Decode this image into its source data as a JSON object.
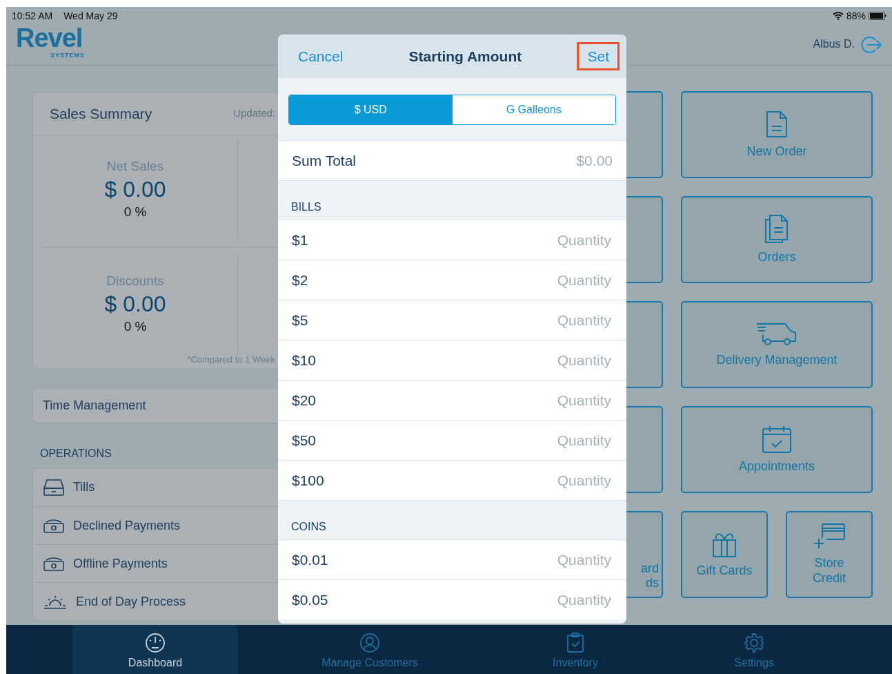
{
  "status_bar": {
    "time": "10:52 AM",
    "date": "Wed May 29",
    "battery": "88%"
  },
  "header": {
    "logo": "Revel",
    "logo_sub": "SYSTEMS",
    "user": "Albus D."
  },
  "sales_summary": {
    "title": "Sales Summary",
    "updated": "Updated:",
    "metrics": [
      {
        "label": "Net Sales",
        "value": "$ 0.00",
        "percent": "0 %"
      },
      {
        "label": "Discounts",
        "value": "$ 0.00",
        "percent": "0 %"
      }
    ],
    "footnote": "*Compared to 1 Week"
  },
  "time_management": "Time Management",
  "operations": {
    "heading": "OPERATIONS",
    "items": [
      {
        "label": "Tills"
      },
      {
        "label": "Declined Payments"
      },
      {
        "label": "Offline Payments"
      },
      {
        "label": "End of Day Process"
      }
    ]
  },
  "partial_tile": {
    "lines": [
      "ard",
      "ds"
    ]
  },
  "tiles": [
    {
      "label": "New Order",
      "kind": "wide"
    },
    {
      "label": "Orders",
      "kind": "wide"
    },
    {
      "label": "Delivery Management",
      "kind": "wide"
    },
    {
      "label": "Appointments",
      "kind": "wide"
    },
    {
      "label": "Gift Cards",
      "kind": "half"
    },
    {
      "label": "Store Credit",
      "kind": "half"
    }
  ],
  "modal": {
    "cancel": "Cancel",
    "title": "Starting Amount",
    "set": "Set",
    "segments": [
      {
        "label": "$ USD",
        "selected": true
      },
      {
        "label": "G Galleons",
        "selected": false
      }
    ],
    "sum_total": {
      "label": "Sum Total",
      "value": "$0.00"
    },
    "sections": [
      {
        "heading": "BILLS",
        "rows": [
          {
            "label": "$1",
            "placeholder": "Quantity"
          },
          {
            "label": "$2",
            "placeholder": "Quantity"
          },
          {
            "label": "$5",
            "placeholder": "Quantity"
          },
          {
            "label": "$10",
            "placeholder": "Quantity"
          },
          {
            "label": "$20",
            "placeholder": "Quantity"
          },
          {
            "label": "$50",
            "placeholder": "Quantity"
          },
          {
            "label": "$100",
            "placeholder": "Quantity"
          }
        ]
      },
      {
        "heading": "COINS",
        "rows": [
          {
            "label": "$0.01",
            "placeholder": "Quantity"
          },
          {
            "label": "$0.05",
            "placeholder": "Quantity"
          }
        ]
      }
    ]
  },
  "tab_bar": [
    {
      "label": "Dashboard",
      "selected": true
    },
    {
      "label": "Manage Customers",
      "selected": false
    },
    {
      "label": "Inventory",
      "selected": false
    },
    {
      "label": "Settings",
      "selected": false
    }
  ]
}
